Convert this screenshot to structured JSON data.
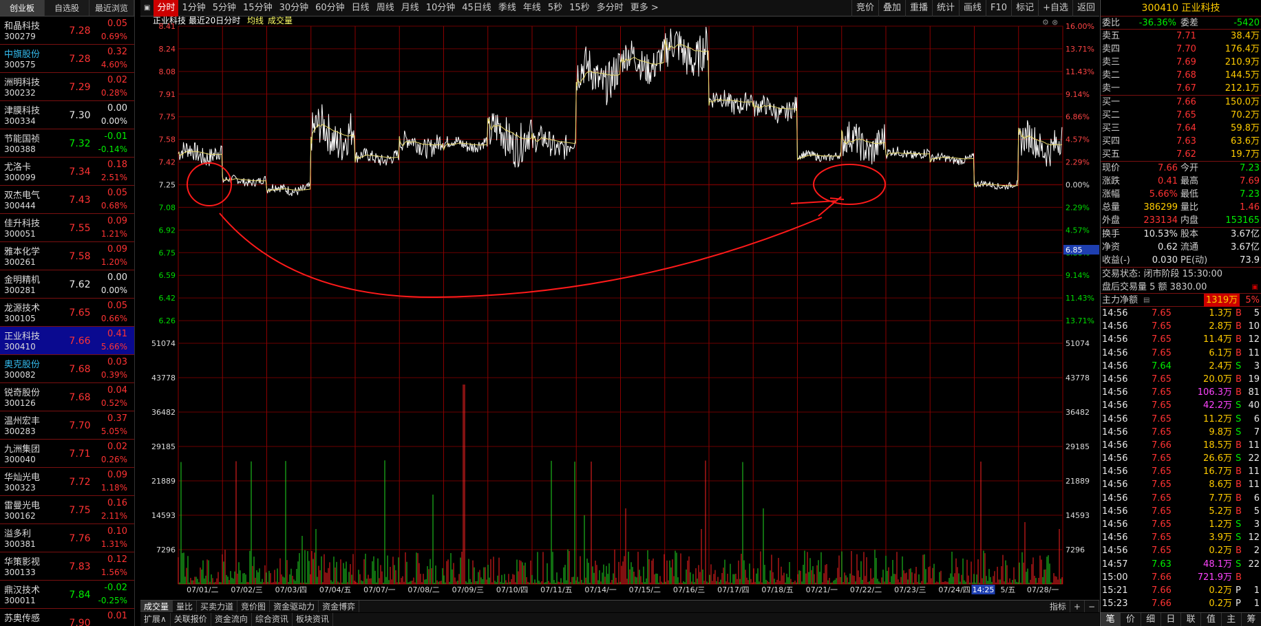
{
  "left": {
    "tabs": [
      "创业板",
      "自选股",
      "最近浏览"
    ],
    "stocks": [
      {
        "name": "和晶科技",
        "code": "300279",
        "price": "7.28",
        "chg": "0.05",
        "pct": "0.69%",
        "dir": "up",
        "blue": false
      },
      {
        "name": "中旗股份",
        "code": "300575",
        "price": "7.28",
        "chg": "0.32",
        "pct": "4.60%",
        "dir": "up",
        "blue": true
      },
      {
        "name": "洲明科技",
        "code": "300232",
        "price": "7.29",
        "chg": "0.02",
        "pct": "0.28%",
        "dir": "up",
        "blue": false
      },
      {
        "name": "津膜科技",
        "code": "300334",
        "price": "7.30",
        "chg": "0.00",
        "pct": "0.00%",
        "dir": "fl",
        "blue": false
      },
      {
        "name": "节能国祯",
        "code": "300388",
        "price": "7.32",
        "chg": "-0.01",
        "pct": "-0.14%",
        "dir": "dn",
        "blue": false
      },
      {
        "name": "尤洛卡",
        "code": "300099",
        "price": "7.34",
        "chg": "0.18",
        "pct": "2.51%",
        "dir": "up",
        "blue": false
      },
      {
        "name": "双杰电气",
        "code": "300444",
        "price": "7.43",
        "chg": "0.05",
        "pct": "0.68%",
        "dir": "up",
        "blue": false
      },
      {
        "name": "佳升科技",
        "code": "300051",
        "price": "7.55",
        "chg": "0.09",
        "pct": "1.21%",
        "dir": "up",
        "blue": false
      },
      {
        "name": "雅本化学",
        "code": "300261",
        "price": "7.58",
        "chg": "0.09",
        "pct": "1.20%",
        "dir": "up",
        "blue": false
      },
      {
        "name": "金明精机",
        "code": "300281",
        "price": "7.62",
        "chg": "0.00",
        "pct": "0.00%",
        "dir": "fl",
        "blue": false
      },
      {
        "name": "龙源技术",
        "code": "300105",
        "price": "7.65",
        "chg": "0.05",
        "pct": "0.66%",
        "dir": "up",
        "blue": false
      },
      {
        "name": "正业科技",
        "code": "300410",
        "price": "7.66",
        "chg": "0.41",
        "pct": "5.66%",
        "dir": "up",
        "blue": false,
        "selected": true
      },
      {
        "name": "奥克股份",
        "code": "300082",
        "price": "7.68",
        "chg": "0.03",
        "pct": "0.39%",
        "dir": "up",
        "blue": true
      },
      {
        "name": "锐奇股份",
        "code": "300126",
        "price": "7.68",
        "chg": "0.04",
        "pct": "0.52%",
        "dir": "up",
        "blue": false
      },
      {
        "name": "温州宏丰",
        "code": "300283",
        "price": "7.70",
        "chg": "0.37",
        "pct": "5.05%",
        "dir": "up",
        "blue": false
      },
      {
        "name": "九洲集团",
        "code": "300040",
        "price": "7.71",
        "chg": "0.02",
        "pct": "0.26%",
        "dir": "up",
        "blue": false
      },
      {
        "name": "华灿光电",
        "code": "300323",
        "price": "7.72",
        "chg": "0.09",
        "pct": "1.18%",
        "dir": "up",
        "blue": false
      },
      {
        "name": "雷曼光电",
        "code": "300162",
        "price": "7.75",
        "chg": "0.16",
        "pct": "2.11%",
        "dir": "up",
        "blue": false
      },
      {
        "name": "溢多利",
        "code": "300381",
        "price": "7.76",
        "chg": "0.10",
        "pct": "1.31%",
        "dir": "up",
        "blue": false
      },
      {
        "name": "华策影视",
        "code": "300133",
        "price": "7.83",
        "chg": "0.12",
        "pct": "1.56%",
        "dir": "up",
        "blue": false
      },
      {
        "name": "鼎汉技术",
        "code": "300011",
        "price": "7.84",
        "chg": "-0.02",
        "pct": "-0.25%",
        "dir": "dn",
        "blue": false
      },
      {
        "name": "苏奥传感",
        "code": "",
        "price": "7.90",
        "chg": "0.01",
        "pct": "",
        "dir": "up",
        "blue": false
      }
    ]
  },
  "toolbar": {
    "items": [
      "分时",
      "1分钟",
      "5分钟",
      "15分钟",
      "30分钟",
      "60分钟",
      "日线",
      "周线",
      "月线",
      "10分钟",
      "45日线",
      "季线",
      "年线",
      "5秒",
      "15秒",
      "多分时",
      "更多 >"
    ],
    "right_items": [
      "竞价",
      "叠加",
      "重播",
      "统计",
      "画线",
      "F10",
      "标记",
      "+自选",
      "返回"
    ]
  },
  "chart": {
    "stock": "正业科技",
    "mode": "最近20日分时",
    "ma_label": "均线",
    "vol_label": "成交量",
    "price_ticks": [
      "8.41",
      "8.24",
      "8.08",
      "7.91",
      "7.75",
      "7.58",
      "7.42",
      "7.25",
      "7.08",
      "6.92",
      "6.75",
      "6.59",
      "6.42",
      "6.26"
    ],
    "pct_ticks": [
      "16.00%",
      "13.71%",
      "11.43%",
      "9.14%",
      "6.86%",
      "4.57%",
      "2.29%",
      "0.00%",
      "2.29%",
      "4.57%",
      "6.86%",
      "9.14%",
      "11.43%",
      "13.71%"
    ],
    "vol_ticks": [
      "51074",
      "43778",
      "36482",
      "29185",
      "21889",
      "14593",
      "7296"
    ],
    "dates": [
      "07/01/二",
      "07/02/三",
      "07/03/四",
      "07/04/五",
      "07/07/一",
      "07/08/二",
      "07/09/三",
      "07/10/四",
      "07/11/五",
      "07/14/一",
      "07/15/二",
      "07/16/三",
      "07/17/四",
      "07/18/五",
      "07/21/一",
      "07/22/二",
      "07/23/三",
      "07/24/四",
      "07/25/五",
      "07/28/一"
    ],
    "time_label": "14:25",
    "cursor_value": "6.85",
    "indicator": "指标"
  },
  "bottom_tabs": [
    "成交量",
    "量比",
    "买卖力道",
    "竞价图",
    "资金驱动力",
    "资金博弈"
  ],
  "bottom_tabs2": [
    "扩展∧",
    "关联报价",
    "资金流向",
    "综合资讯",
    "板块资讯"
  ],
  "right": {
    "code": "300410",
    "name": "正业科技",
    "weibi_label": "委比",
    "weibi": "-36.36%",
    "weicha_label": "委差",
    "weicha": "-5420",
    "asks": [
      {
        "l": "卖五",
        "p": "7.71",
        "v": "38.4万"
      },
      {
        "l": "卖四",
        "p": "7.70",
        "v": "176.4万"
      },
      {
        "l": "卖三",
        "p": "7.69",
        "v": "210.9万"
      },
      {
        "l": "卖二",
        "p": "7.68",
        "v": "144.5万"
      },
      {
        "l": "卖一",
        "p": "7.67",
        "v": "212.1万"
      }
    ],
    "bids": [
      {
        "l": "买一",
        "p": "7.66",
        "v": "150.0万"
      },
      {
        "l": "买二",
        "p": "7.65",
        "v": "70.2万"
      },
      {
        "l": "买三",
        "p": "7.64",
        "v": "59.8万"
      },
      {
        "l": "买四",
        "p": "7.63",
        "v": "63.6万"
      },
      {
        "l": "买五",
        "p": "7.62",
        "v": "19.7万"
      }
    ],
    "stats": [
      [
        "现价",
        "7.66",
        "今开",
        "7.23"
      ],
      [
        "涨跌",
        "0.41",
        "最高",
        "7.69"
      ],
      [
        "涨幅",
        "5.66%",
        "最低",
        "7.23"
      ],
      [
        "总量",
        "386299",
        "量比",
        "1.46"
      ],
      [
        "外盘",
        "233134",
        "内盘",
        "153165"
      ]
    ],
    "stats2": [
      [
        "换手",
        "10.53%",
        "股本",
        "3.67亿"
      ],
      [
        "净资",
        "0.62",
        "流通",
        "3.67亿"
      ],
      [
        "收益(-)",
        "0.030",
        "PE(动)",
        "73.9"
      ]
    ],
    "status": "交易状态: 闭市阶段 15:30:00",
    "after": "盘后交易量 5 额 3830.00",
    "zhuli_label": "主力净额",
    "zhuli": "1319万",
    "zhuli_pct": "5%",
    "trades": [
      [
        "14:56",
        "7.65",
        "1.3万",
        "B",
        "5"
      ],
      [
        "14:56",
        "7.65",
        "2.8万",
        "B",
        "10"
      ],
      [
        "14:56",
        "7.65",
        "11.4万",
        "B",
        "12"
      ],
      [
        "14:56",
        "7.65",
        "6.1万",
        "B",
        "11"
      ],
      [
        "14:56",
        "7.64",
        "2.4万",
        "S",
        "3"
      ],
      [
        "14:56",
        "7.65",
        "20.0万",
        "B",
        "19"
      ],
      [
        "14:56",
        "7.65",
        "106.3万",
        "B",
        "81"
      ],
      [
        "14:56",
        "7.65",
        "42.2万",
        "S",
        "40"
      ],
      [
        "14:56",
        "7.65",
        "11.2万",
        "S",
        "6"
      ],
      [
        "14:56",
        "7.65",
        "9.8万",
        "S",
        "7"
      ],
      [
        "14:56",
        "7.66",
        "18.5万",
        "B",
        "11"
      ],
      [
        "14:56",
        "7.65",
        "26.6万",
        "S",
        "22"
      ],
      [
        "14:56",
        "7.65",
        "16.7万",
        "B",
        "11"
      ],
      [
        "14:56",
        "7.65",
        "8.6万",
        "B",
        "11"
      ],
      [
        "14:56",
        "7.65",
        "7.7万",
        "B",
        "6"
      ],
      [
        "14:56",
        "7.65",
        "5.2万",
        "B",
        "5"
      ],
      [
        "14:56",
        "7.65",
        "1.2万",
        "S",
        "3"
      ],
      [
        "14:56",
        "7.65",
        "3.9万",
        "S",
        "12"
      ],
      [
        "14:56",
        "7.65",
        "0.2万",
        "B",
        "2"
      ],
      [
        "14:57",
        "7.63",
        "48.1万",
        "S",
        "22"
      ],
      [
        "15:00",
        "7.66",
        "721.9万",
        "B",
        ""
      ],
      [
        "15:21",
        "7.66",
        "0.2万",
        "P",
        "1"
      ],
      [
        "15:23",
        "7.66",
        "0.2万",
        "P",
        "1"
      ]
    ],
    "bottom": [
      "笔",
      "价",
      "细",
      "日",
      "联",
      "值",
      "主",
      "筹"
    ]
  }
}
